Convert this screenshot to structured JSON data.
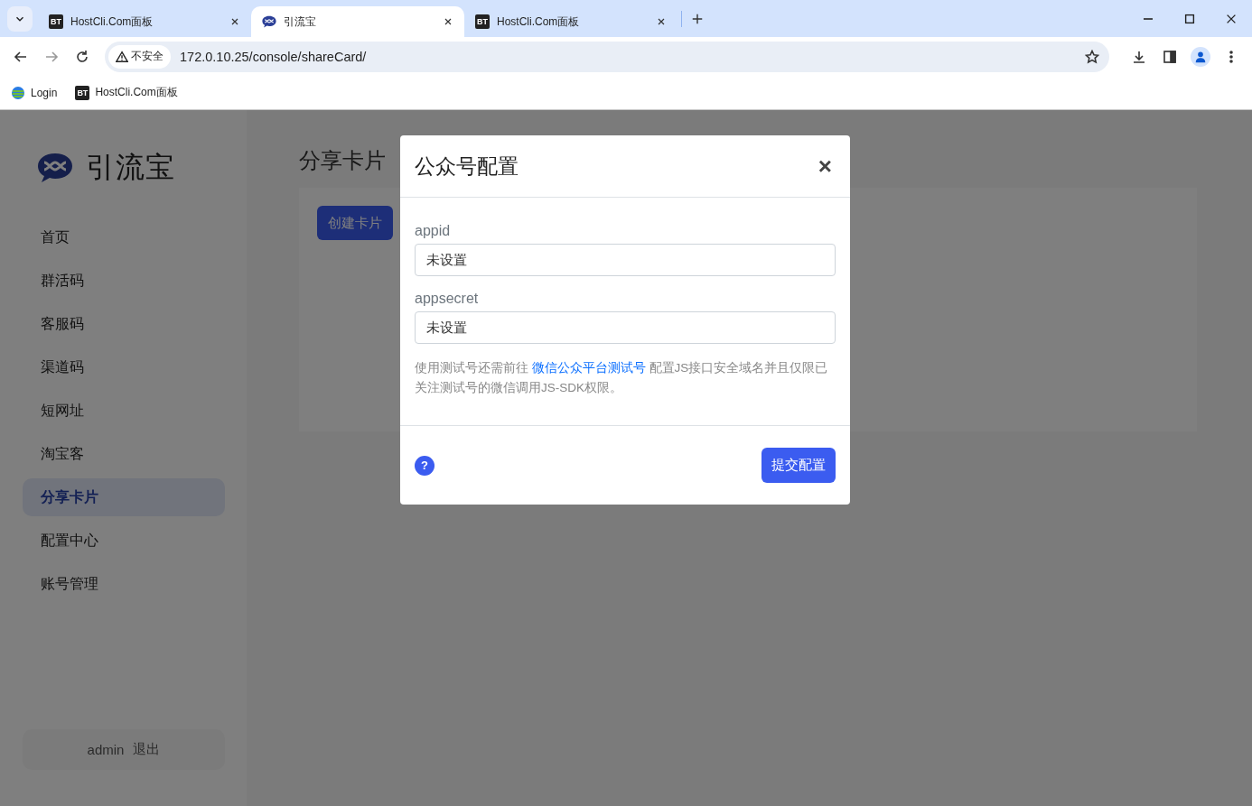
{
  "browser": {
    "tabs": [
      {
        "title": "HostCli.Com面板",
        "kind": "text",
        "favicon": "BT",
        "selected": false
      },
      {
        "title": "引流宝",
        "kind": "logo",
        "selected": true
      },
      {
        "title": "HostCli.Com面板",
        "kind": "text",
        "favicon": "BT",
        "selected": false
      }
    ],
    "address": {
      "security": "不安全",
      "url": "172.0.10.25/console/shareCard/"
    },
    "bookmarks": [
      {
        "label": "Login",
        "kind": "globe"
      },
      {
        "label": "HostCli.Com面板",
        "kind": "text",
        "favicon": "BT"
      }
    ]
  },
  "sidebar": {
    "brand": "引流宝",
    "items": [
      {
        "label": "首页",
        "selected": false
      },
      {
        "label": "群活码",
        "selected": false
      },
      {
        "label": "客服码",
        "selected": false
      },
      {
        "label": "渠道码",
        "selected": false
      },
      {
        "label": "短网址",
        "selected": false
      },
      {
        "label": "淘宝客",
        "selected": false
      },
      {
        "label": "分享卡片",
        "selected": true
      },
      {
        "label": "配置中心",
        "selected": false
      },
      {
        "label": "账号管理",
        "selected": false
      }
    ],
    "user": "admin",
    "logout": "退出"
  },
  "main": {
    "title": "分享卡片",
    "create_button": "创建卡片"
  },
  "modal": {
    "title": "公众号配置",
    "close": "×",
    "fields": [
      {
        "label": "appid",
        "value": "未设置"
      },
      {
        "label": "appsecret",
        "value": "未设置"
      }
    ],
    "note": {
      "before": "使用测试号还需前往 ",
      "link": "微信公众平台测试号",
      "after": " 配置JS接口安全域名并且仅限已关注测试号的微信调用JS-SDK权限。"
    },
    "help": "?",
    "submit": "提交配置"
  }
}
